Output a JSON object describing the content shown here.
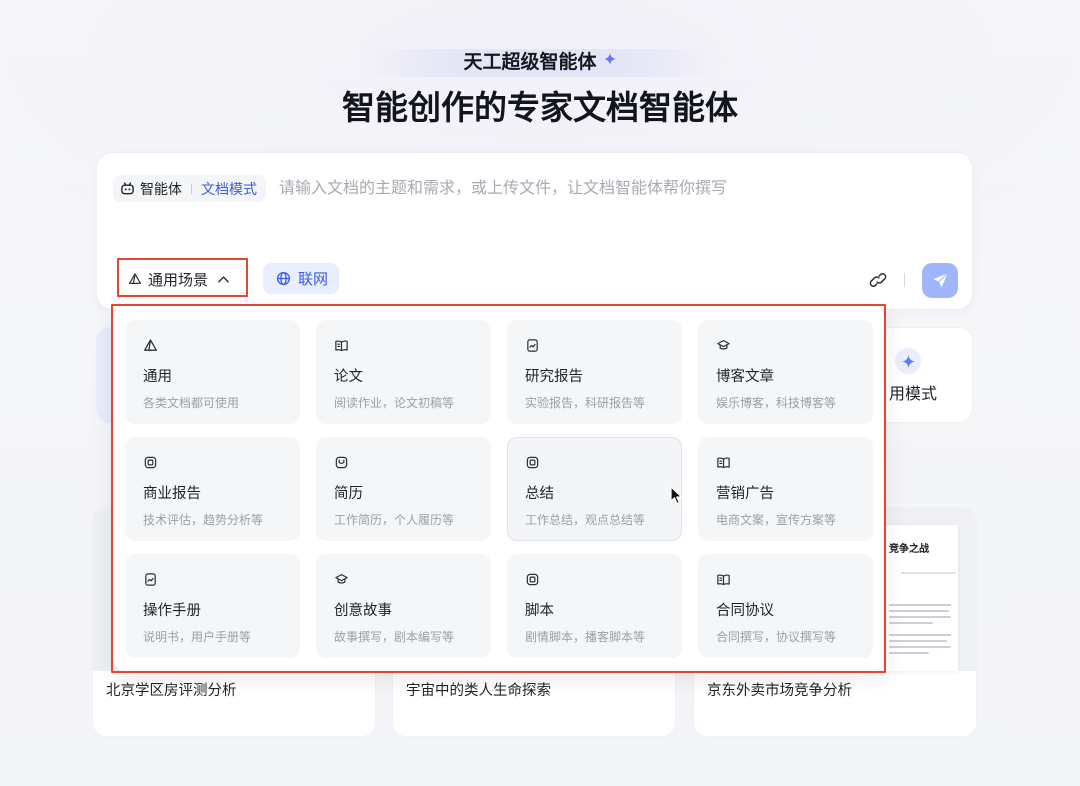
{
  "header": {
    "badge": "天工超级智能体",
    "badge_icon": "sparkle-icon",
    "title": "智能创作的专家文档智能体"
  },
  "composer": {
    "agent_icon": "robot-icon",
    "agent_label": "智能体",
    "mode_label": "文档模式",
    "placeholder": "请输入文档的主题和需求，或上传文件，让文档智能体帮你撰写",
    "scene_selector": {
      "icon": "triangle-icon",
      "label": "通用场景",
      "chevron": "chevron-up-icon"
    },
    "web_toggle": {
      "icon": "globe-icon",
      "label": "联网"
    },
    "attach_icon": "link-icon",
    "send_icon": "send-icon"
  },
  "scene_menu": {
    "items": [
      {
        "icon": "triangle-icon",
        "title": "通用",
        "desc": "各类文档都可使用"
      },
      {
        "icon": "book-open-icon",
        "title": "论文",
        "desc": "阅读作业，论文初稿等"
      },
      {
        "icon": "document-chart-icon",
        "title": "研究报告",
        "desc": "实验报告，科研报告等"
      },
      {
        "icon": "graduation-cap-icon",
        "title": "博客文章",
        "desc": "娱乐博客，科技博客等"
      },
      {
        "icon": "board-icon",
        "title": "商业报告",
        "desc": "技术评估，趋势分析等"
      },
      {
        "icon": "profile-icon",
        "title": "简历",
        "desc": "工作简历，个人履历等"
      },
      {
        "icon": "board-icon",
        "title": "总结",
        "desc": "工作总结，观点总结等",
        "hovered": true
      },
      {
        "icon": "book-open-icon",
        "title": "营销广告",
        "desc": "电商文案，宣传方案等"
      },
      {
        "icon": "document-chart-icon",
        "title": "操作手册",
        "desc": "说明书，用户手册等"
      },
      {
        "icon": "graduation-cap-icon",
        "title": "创意故事",
        "desc": "故事撰写，剧本编写等"
      },
      {
        "icon": "board-icon",
        "title": "脚本",
        "desc": "剧情脚本，播客脚本等"
      },
      {
        "icon": "book-open-icon",
        "title": "合同协议",
        "desc": "合同撰写，协议撰写等"
      }
    ]
  },
  "mode_card": {
    "icon": "sparkle-icon",
    "label": "用模式"
  },
  "examples": [
    {
      "title": "北京学区房评测分析"
    },
    {
      "title": "宇宙中的类人生命探索"
    },
    {
      "title": "京东外卖市场竞争分析",
      "preview_heading": "竞争之战"
    }
  ],
  "colors": {
    "accent": "#3b5ce6",
    "highlight_border": "#e2472f",
    "send_button": "#9fb6fa",
    "web_chip_bg": "#e9eefc"
  }
}
